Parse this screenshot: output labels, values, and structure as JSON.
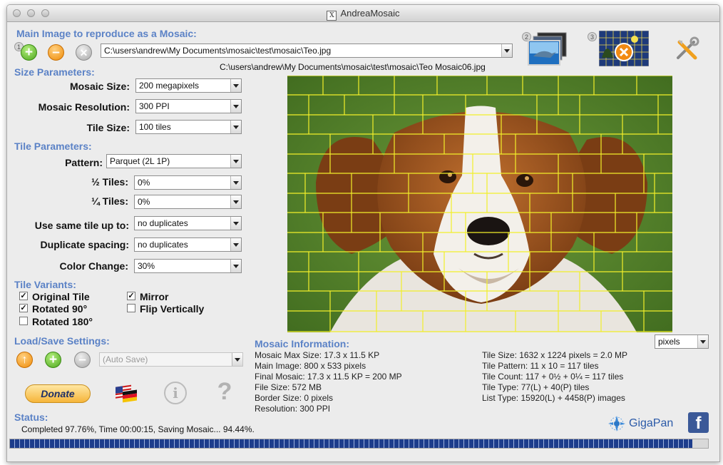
{
  "window": {
    "title": "AndreaMosaic"
  },
  "main_image": {
    "section_label": "Main Image to reproduce as a Mosaic:",
    "path": "C:\\users\\andrew\\My Documents\\mosaic\\test\\mosaic\\Teo.jpg",
    "output_path": "C:\\users\\andrew\\My Documents\\mosaic\\test\\mosaic\\Teo Mosaic06.jpg",
    "step1_badge": "1",
    "step2_badge": "2",
    "step3_badge": "3"
  },
  "size_params": {
    "section_label": "Size Parameters:",
    "mosaic_size_label": "Mosaic Size:",
    "mosaic_size_value": "200 megapixels",
    "resolution_label": "Mosaic Resolution:",
    "resolution_value": "300 PPI",
    "tile_size_label": "Tile Size:",
    "tile_size_value": "100 tiles"
  },
  "tile_params": {
    "section_label": "Tile Parameters:",
    "pattern_label": "Pattern:",
    "pattern_value": "Parquet (2L 1P)",
    "half_tiles_label": "½ Tiles:",
    "half_tiles_value": "0%",
    "quarter_tiles_label": "¼ Tiles:",
    "quarter_tiles_value": "0%",
    "same_tile_label": "Use same tile up to:",
    "same_tile_value": "no duplicates",
    "dup_spacing_label": "Duplicate spacing:",
    "dup_spacing_value": "no duplicates",
    "color_change_label": "Color Change:",
    "color_change_value": "30%"
  },
  "tile_variants": {
    "section_label": "Tile Variants:",
    "original": {
      "label": "Original Tile",
      "checked": true
    },
    "rotated90": {
      "label": "Rotated 90°",
      "checked": true
    },
    "rotated180": {
      "label": "Rotated 180°",
      "checked": false
    },
    "mirror": {
      "label": "Mirror",
      "checked": true
    },
    "flip": {
      "label": "Flip Vertically",
      "checked": false
    }
  },
  "load_save": {
    "section_label": "Load/Save Settings:",
    "settings_value": "(Auto Save)"
  },
  "buttons": {
    "donate": "Donate"
  },
  "units_select": {
    "value": "pixels"
  },
  "mosaic_info": {
    "section_label": "Mosaic Information:",
    "left": [
      "Mosaic Max Size: 17.3 x 11.5 KP",
      "Main Image: 800 x 533 pixels",
      "Final Mosaic: 17.3 x 11.5 KP = 200 MP",
      "File Size: 572 MB",
      "Border Size: 0 pixels",
      "Resolution: 300 PPI"
    ],
    "right": [
      "Tile Size: 1632 x 1224 pixels = 2.0 MP",
      "Tile Pattern: 11 x 10 = 117 tiles",
      "Tile Count: 117 + 0½ + 0¼ = 117 tiles",
      "Tile Type: 77(L) + 40(P) tiles",
      "List Type: 15920(L) + 4458(P) images"
    ]
  },
  "status": {
    "section_label": "Status:",
    "text": "Completed 97.76%, Time 00:00:15, Saving Mosaic... 94.44%.",
    "progress": 0.978
  },
  "branding": {
    "gigapan": "GigaPan",
    "facebook": "f"
  },
  "colors": {
    "accent": "#5b82c6",
    "progress": "#1f3f8f",
    "grid": "#f2ef2a"
  },
  "icons": {
    "add": "plus-circle-icon",
    "remove": "minus-circle-icon",
    "clear": "x-circle-icon",
    "tools": "tools-icon",
    "info": "info-icon",
    "help": "question-icon",
    "flags": "language-flags-icon",
    "load": "up-arrow-circle-icon"
  }
}
